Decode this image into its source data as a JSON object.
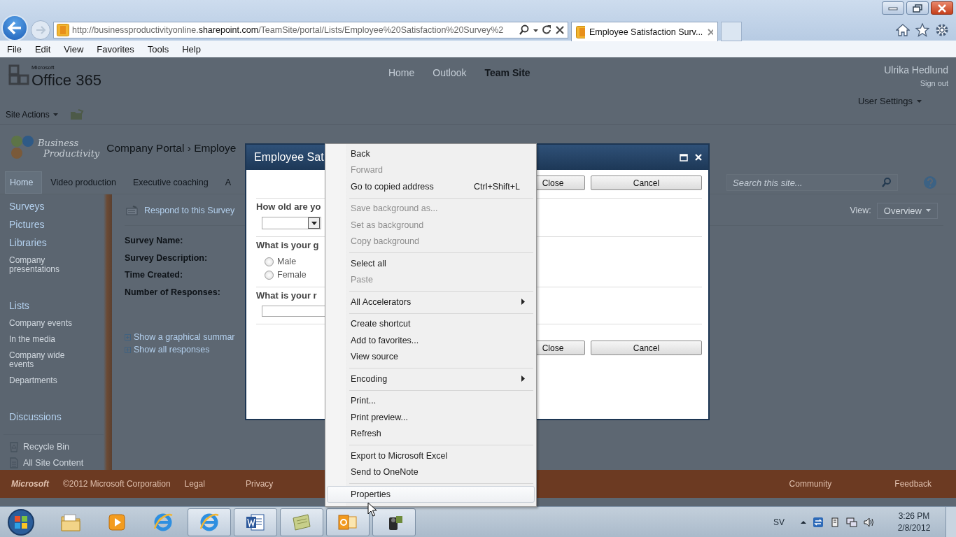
{
  "browser": {
    "address": "http://businessproductivityonline.**sharepoint.com**/TeamSite/portal/Lists/Employee%20Satisfaction%20Survey%2",
    "tabs": [
      {
        "title": "Employee Satisfaction Surv...",
        "selected": true
      }
    ],
    "menu": [
      "File",
      "Edit",
      "View",
      "Favorites",
      "Tools",
      "Help"
    ]
  },
  "site": {
    "brand_small": "Microsoft",
    "brand": "Office 365",
    "top_nav": [
      {
        "label": "Home",
        "selected": false
      },
      {
        "label": "Outlook",
        "selected": false
      },
      {
        "label": "Team Site",
        "selected": true
      }
    ],
    "user": "Ulrika Hedlund",
    "sign_out": "Sign out",
    "site_actions": "Site Actions",
    "user_settings": "User Settings",
    "logo_lines": [
      "Business",
      "Productivity"
    ],
    "breadcrumb": "Company Portal › Employe",
    "tabs": [
      {
        "label": "Home",
        "selected": true
      },
      {
        "label": "Video production",
        "selected": false
      },
      {
        "label": "Executive coaching",
        "selected": false
      },
      {
        "label": "A",
        "selected": false
      }
    ],
    "search": {
      "placeholder": "Search this site..."
    },
    "quick_launch": [
      {
        "heading": "Surveys"
      },
      {
        "heading": "Pictures"
      },
      {
        "heading": "Libraries",
        "items": [
          "Company presentations"
        ]
      },
      {
        "heading": "Lists",
        "items": [
          "Company events",
          "In the media",
          "Company wide events",
          "Departments"
        ]
      },
      {
        "heading": "Discussions"
      }
    ],
    "utilities": [
      {
        "label": "Recycle Bin",
        "kind": "bin"
      },
      {
        "label": "All Site Content",
        "kind": "pages"
      }
    ],
    "respond": "Respond to this Survey",
    "view_label": "View:",
    "view_value": "Overview",
    "fields": [
      "Survey Name:",
      "Survey Description:",
      "Time Created:",
      "Number of Responses:"
    ],
    "links": [
      "Show a graphical summar",
      "Show all responses"
    ],
    "footer": {
      "logo": "Microsoft",
      "copyright": "©2012 Microsoft Corporation",
      "left_links": [
        "Legal",
        "Privacy"
      ],
      "right_links": [
        "Community",
        "Feedback"
      ]
    }
  },
  "dialog": {
    "title": "Employee Sat",
    "buttons_top": [
      "Close",
      "Cancel"
    ],
    "buttons_bottom": [
      "Close",
      "Cancel"
    ],
    "questions": [
      {
        "text": "How old are yo",
        "kind": "dropdown"
      },
      {
        "text": "What is your g",
        "kind": "radio",
        "options": [
          {
            "label": "Male",
            "selected": false
          },
          {
            "label": "Female",
            "selected": false
          }
        ]
      },
      {
        "text": "What is your r",
        "kind": "text"
      }
    ]
  },
  "context_menu": {
    "groups": [
      [
        {
          "label": "Back",
          "disabled": false,
          "submenu": false,
          "selected": false
        },
        {
          "label": "Forward",
          "disabled": true,
          "submenu": false,
          "selected": false
        },
        {
          "label": "Go to copied address",
          "shortcut": "Ctrl+Shift+L",
          "disabled": false,
          "submenu": false,
          "selected": false
        }
      ],
      [
        {
          "label": "Save background as...",
          "disabled": true,
          "submenu": false,
          "selected": false
        },
        {
          "label": "Set as background",
          "disabled": true,
          "submenu": false,
          "selected": false
        },
        {
          "label": "Copy background",
          "disabled": true,
          "submenu": false,
          "selected": false
        }
      ],
      [
        {
          "label": "Select all",
          "disabled": false,
          "submenu": false,
          "selected": false
        },
        {
          "label": "Paste",
          "disabled": true,
          "submenu": false,
          "selected": false
        }
      ],
      [
        {
          "label": "All Accelerators",
          "disabled": false,
          "submenu": true,
          "selected": false
        }
      ],
      [
        {
          "label": "Create shortcut",
          "disabled": false,
          "submenu": false,
          "selected": false
        },
        {
          "label": "Add to favorites...",
          "disabled": false,
          "submenu": false,
          "selected": false
        },
        {
          "label": "View source",
          "disabled": false,
          "submenu": false,
          "selected": false
        }
      ],
      [
        {
          "label": "Encoding",
          "disabled": false,
          "submenu": true,
          "selected": false
        }
      ],
      [
        {
          "label": "Print...",
          "disabled": false,
          "submenu": false,
          "selected": false
        },
        {
          "label": "Print preview...",
          "disabled": false,
          "submenu": false,
          "selected": false
        },
        {
          "label": "Refresh",
          "disabled": false,
          "submenu": false,
          "selected": false
        }
      ],
      [
        {
          "label": "Export to Microsoft Excel",
          "disabled": false,
          "submenu": false,
          "selected": false
        },
        {
          "label": "Send to OneNote",
          "disabled": false,
          "submenu": false,
          "selected": false
        }
      ],
      [
        {
          "label": "Properties",
          "disabled": false,
          "submenu": false,
          "selected": true
        }
      ]
    ]
  },
  "taskbar": {
    "apps": [
      {
        "kind": "folder",
        "running": false
      },
      {
        "kind": "media",
        "running": false
      },
      {
        "kind": "ie",
        "running": false
      },
      {
        "kind": "ie",
        "running": true
      },
      {
        "kind": "word",
        "running": true
      },
      {
        "kind": "note",
        "running": true
      },
      {
        "kind": "outlook",
        "running": true
      },
      {
        "kind": "camera",
        "running": true
      }
    ],
    "language": "SV",
    "time": "3:26 PM",
    "date": "2/8/2012"
  }
}
